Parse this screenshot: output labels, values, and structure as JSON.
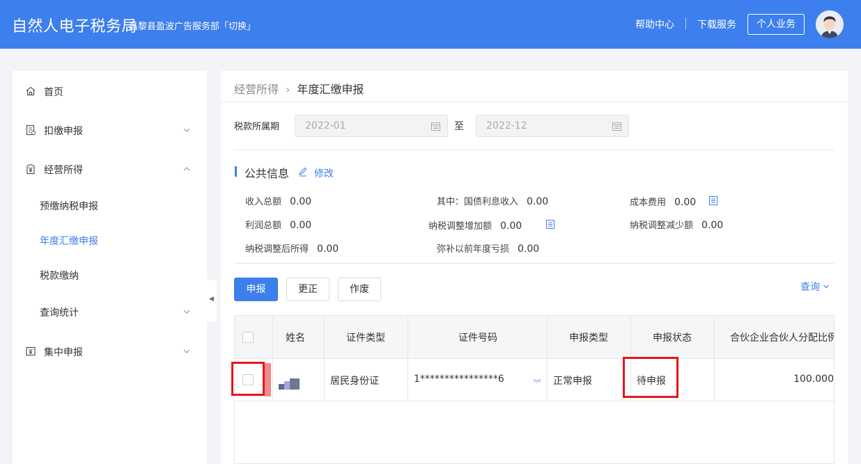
{
  "header": {
    "title": "自然人电子税务局",
    "org": "昌黎县盈波广告服务部「切换」",
    "help": "帮助中心",
    "download": "下载服务",
    "personal": "个人业务",
    "colors": {
      "primary": "#3d7fec"
    }
  },
  "sidebar": {
    "items": [
      {
        "label": "首页",
        "icon": "home-icon"
      },
      {
        "label": "扣缴申报",
        "icon": "document-icon"
      },
      {
        "label": "经营所得",
        "icon": "yen-icon"
      },
      {
        "label": "集中申报",
        "icon": "yen-box-icon"
      }
    ],
    "subitems": [
      "预缴纳税申报",
      "年度汇缴申报",
      "税款缴纳",
      "查询统计"
    ],
    "active": "年度汇缴申报"
  },
  "breadcrumb": {
    "parent": "经营所得",
    "current": "年度汇缴申报"
  },
  "period": {
    "label": "税款所属期",
    "start": "2022-01",
    "to": "至",
    "end": "2022-12"
  },
  "public_info": {
    "title": "公共信息",
    "edit": "修改",
    "rows": [
      [
        {
          "label": "收入总额",
          "value": "0.00"
        },
        {
          "label": "其中：国债利息收入",
          "value": "0.00"
        },
        {
          "label": "成本费用",
          "value": "0.00"
        }
      ],
      [
        {
          "label": "利润总额",
          "value": "0.00"
        },
        {
          "label": "纳税调整增加额",
          "value": "0.00"
        },
        {
          "label": "纳税调整减少额",
          "value": "0.00"
        }
      ],
      [
        {
          "label": "纳税调整后所得",
          "value": "0.00"
        },
        {
          "label": "弥补以前年度亏损",
          "value": "0.00"
        }
      ]
    ]
  },
  "actions": {
    "declare": "申报",
    "correct": "更正",
    "void": "作废",
    "query": "查询"
  },
  "table": {
    "headers": [
      "姓名",
      "证件类型",
      "证件号码",
      "申报类型",
      "申报状态",
      "合伙企业合伙人分配比例"
    ],
    "rows": [
      {
        "id_type": "居民身份证",
        "id_number": "1****************6",
        "declare_type": "正常申报",
        "status": "待申报",
        "ratio": "100.000"
      }
    ]
  }
}
